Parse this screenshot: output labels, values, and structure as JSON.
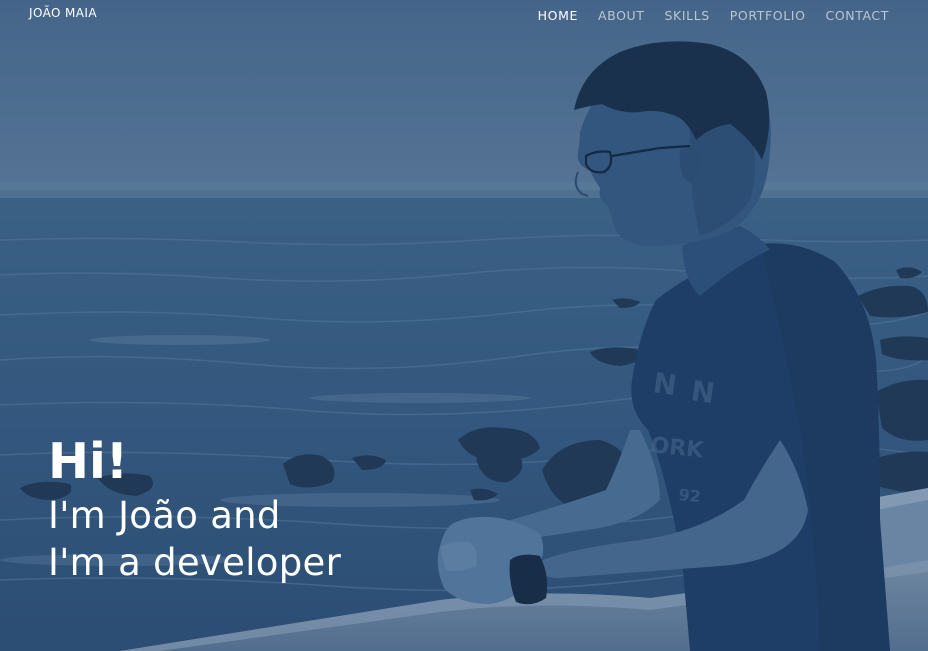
{
  "nav": {
    "brand": "JOÃO MAIA",
    "items": [
      {
        "label": "HOME",
        "active": true
      },
      {
        "label": "ABOUT",
        "active": false
      },
      {
        "label": "SKILLS",
        "active": false
      },
      {
        "label": "PORTFOLIO",
        "active": false
      },
      {
        "label": "CONTACT",
        "active": false
      }
    ]
  },
  "hero": {
    "greeting": "Hi!",
    "line1": "I'm João and",
    "line2": "I'm a developer"
  },
  "colors": {
    "overlay": "#2f5379",
    "text": "#ffffff"
  },
  "icons": {
    "background": "photo-of-man-by-the-sea"
  }
}
